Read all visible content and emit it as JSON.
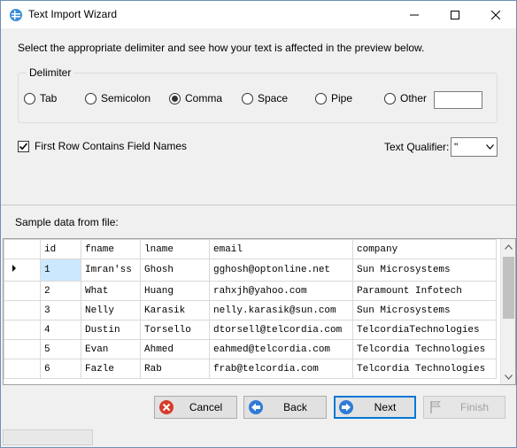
{
  "window": {
    "title": "Text Import Wizard",
    "instructions": "Select the appropriate delimiter and see how your text is affected in the preview below."
  },
  "delimiter": {
    "group_label": "Delimiter",
    "options": [
      "Tab",
      "Semicolon",
      "Comma",
      "Space",
      "Pipe",
      "Other"
    ],
    "selected": "Comma",
    "other_value": ""
  },
  "first_row": {
    "label": "First Row Contains Field Names",
    "checked": true
  },
  "qualifier": {
    "label": "Text Qualifier:",
    "value": "\""
  },
  "sample": {
    "label": "Sample data from file:",
    "columns": [
      "id",
      "fname",
      "lname",
      "email",
      "company"
    ],
    "rows": [
      [
        "1",
        "Imran'ss",
        "Ghosh",
        "gghosh@optonline.net",
        "Sun Microsystems"
      ],
      [
        "2",
        "What",
        "Huang",
        "rahxjh@yahoo.com",
        "Paramount Infotech"
      ],
      [
        "3",
        "Nelly",
        "Karasik",
        "nelly.karasik@sun.com",
        "Sun Microsystems"
      ],
      [
        "4",
        "Dustin",
        "Torsello",
        "dtorsell@telcordia.com",
        "TelcordiaTechnologies"
      ],
      [
        "5",
        "Evan",
        "Ahmed",
        "eahmed@telcordia.com",
        "Telcordia Technologies"
      ],
      [
        "6",
        "Fazle",
        "Rab",
        "frab@telcordia.com",
        "Telcordia Technologies"
      ]
    ],
    "selected_row": 0
  },
  "buttons": {
    "cancel": "Cancel",
    "back": "Back",
    "next": "Next",
    "finish": "Finish"
  },
  "colors": {
    "selection": "#cce8ff",
    "accent": "#0078d7"
  }
}
